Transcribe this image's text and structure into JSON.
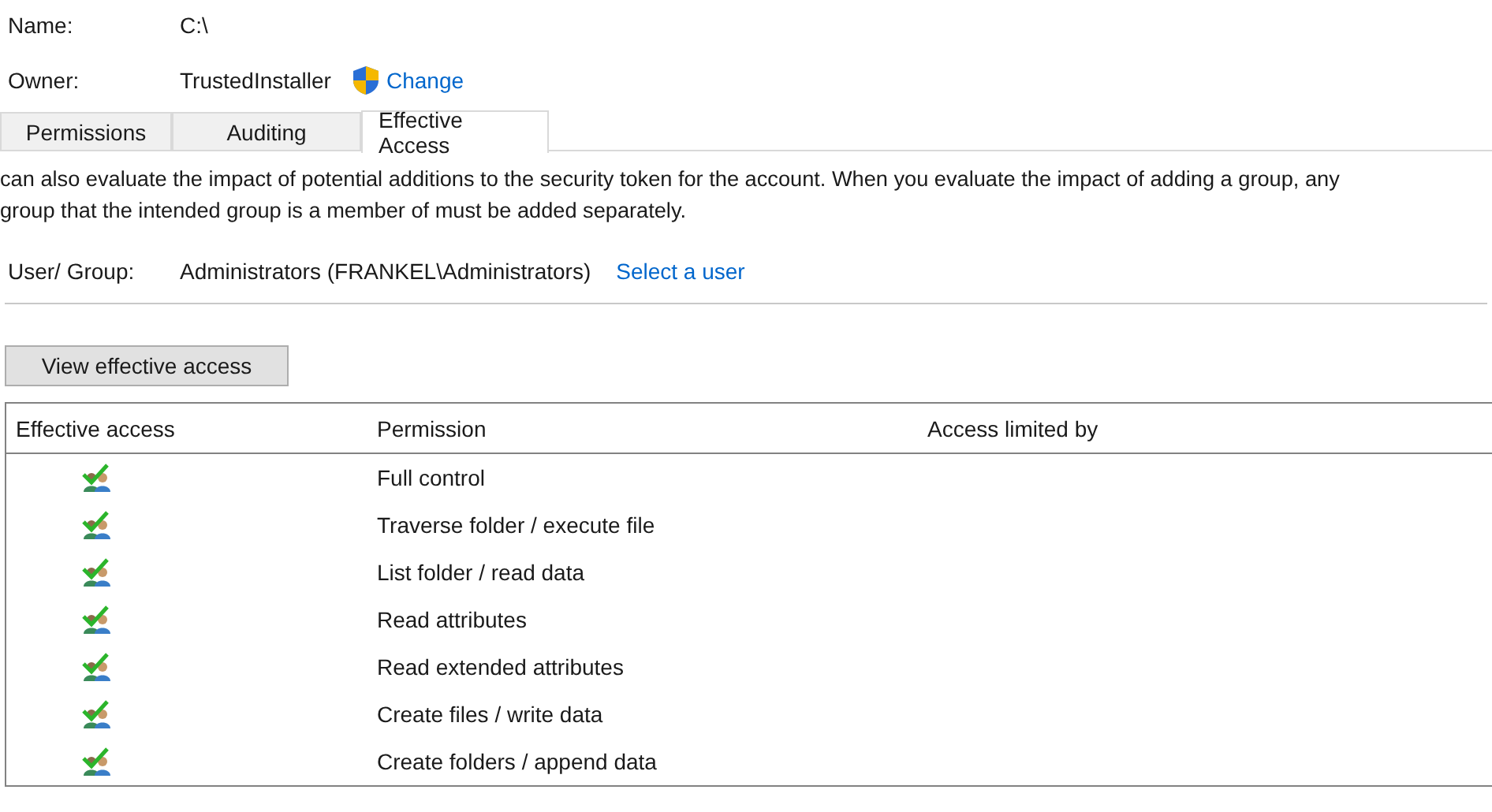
{
  "name": {
    "label": "Name:",
    "value": "C:\\"
  },
  "owner": {
    "label": "Owner:",
    "value": "TrustedInstaller",
    "change_link": "Change"
  },
  "tabs": [
    {
      "label": "Permissions",
      "selected": false
    },
    {
      "label": "Auditing",
      "selected": false
    },
    {
      "label": "Effective Access",
      "selected": true
    }
  ],
  "description_lines": [
    "can also evaluate the impact of potential additions to the security token for the account. When you evaluate the impact of adding a group, any",
    "group that the intended group is a member of must be added separately."
  ],
  "user_group": {
    "label": "User/ Group:",
    "value": "Administrators (FRANKEL\\Administrators)",
    "link": "Select a user"
  },
  "view_button": "View effective access",
  "table": {
    "columns": [
      "Effective access",
      "Permission",
      "Access limited by"
    ],
    "rows": [
      {
        "allowed": true,
        "permission": "Full control"
      },
      {
        "allowed": true,
        "permission": "Traverse folder / execute file"
      },
      {
        "allowed": true,
        "permission": "List folder / read data"
      },
      {
        "allowed": true,
        "permission": "Read attributes"
      },
      {
        "allowed": true,
        "permission": "Read extended attributes"
      },
      {
        "allowed": true,
        "permission": "Create files / write data"
      },
      {
        "allowed": true,
        "permission": "Create folders / append data"
      }
    ]
  }
}
